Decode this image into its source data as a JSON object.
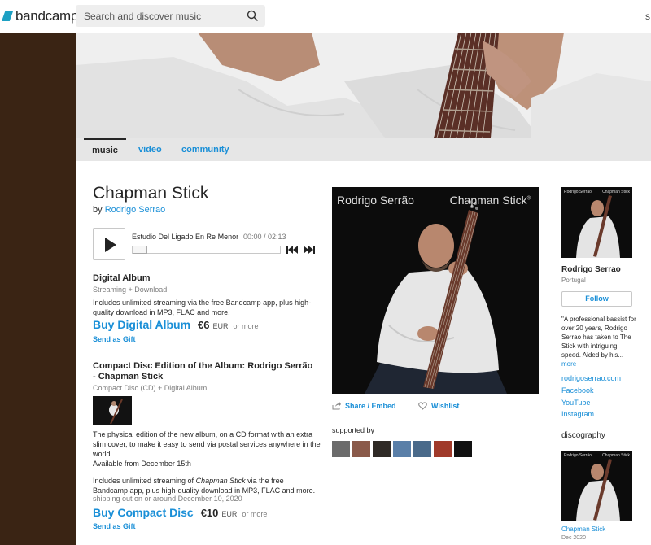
{
  "topbar": {
    "logo_text": "bandcamp",
    "search_placeholder": "Search and discover music",
    "edge_mark": "s"
  },
  "nav": {
    "tabs": [
      {
        "label": "music",
        "active": true
      },
      {
        "label": "video",
        "active": false
      },
      {
        "label": "community",
        "active": false
      }
    ]
  },
  "album": {
    "title": "Chapman Stick",
    "by_prefix": "by",
    "artist": "Rodrigo Serrao",
    "art_artist_text": "Rodrigo Serrão",
    "art_title_text": "Chapman Stick",
    "art_title_tm": "®"
  },
  "player": {
    "track_title": "Estudio Del Ligado En Re Menor",
    "time": "00:00 / 02:13",
    "progress": 0
  },
  "digital": {
    "title": "Digital Album",
    "subtitle": "Streaming + Download",
    "desc": "Includes unlimited streaming via the free Bandcamp app, plus high-quality download in MP3, FLAC and more.",
    "buy_label": "Buy Digital Album",
    "price": "€6",
    "currency": "EUR",
    "or_more": "or more",
    "gift_label": "Send as Gift"
  },
  "cd": {
    "title": "Compact Disc Edition of the Album: Rodrigo Serrão - Chapman Stick",
    "subtitle": "Compact Disc (CD) + Digital Album",
    "desc1": "The physical edition of the new album, on a CD format with an extra slim cover, to make it easy to send via postal services anywhere in the world.",
    "desc2": "Available from December 15th",
    "desc3_a": "Includes unlimited streaming of ",
    "desc3_em": "Chapman Stick",
    "desc3_b": " via the free Bandcamp app, plus high-quality download in MP3, FLAC and more.",
    "shipping": "shipping out on or around December 10, 2020",
    "buy_label": "Buy Compact Disc",
    "price": "€10",
    "currency": "EUR",
    "or_more": "or more",
    "gift_label": "Send as Gift"
  },
  "actions": {
    "share_label": "Share / Embed",
    "wishlist_label": "Wishlist",
    "supported_by": "supported by"
  },
  "supporters": [
    {
      "icon": "supporter-avatar-1",
      "color": "#6b6b6b"
    },
    {
      "icon": "supporter-avatar-2",
      "color": "#8a5a4a"
    },
    {
      "icon": "supporter-avatar-3",
      "color": "#2f2a26"
    },
    {
      "icon": "supporter-avatar-4",
      "color": "#5a7fa8"
    },
    {
      "icon": "supporter-avatar-5",
      "color": "#4a6a8a"
    },
    {
      "icon": "supporter-avatar-6",
      "color": "#a03a2a"
    },
    {
      "icon": "supporter-avatar-7",
      "color": "#111111"
    }
  ],
  "artist_panel": {
    "name": "Rodrigo Serrao",
    "location": "Portugal",
    "follow_label": "Follow",
    "bio": "\"A professional bassist for over 20 years, Rodrigo Serrao has taken to The Stick with intriguing speed. Aided by his...",
    "bio_more": "more",
    "links": [
      "rodrigoserrao.com",
      "Facebook",
      "YouTube",
      "Instagram"
    ],
    "mini_artist": "Rodrigo Serrão",
    "mini_title": "Chapman Stick"
  },
  "discography": {
    "label": "discography",
    "item_title": "Chapman Stick",
    "item_date": "Dec 2020"
  },
  "colors": {
    "link_blue": "#1a8fd7",
    "page_bg_brown": "#3a2414",
    "nav_bg": "#e6e6e6",
    "logo_blue": "#1da0c3"
  }
}
